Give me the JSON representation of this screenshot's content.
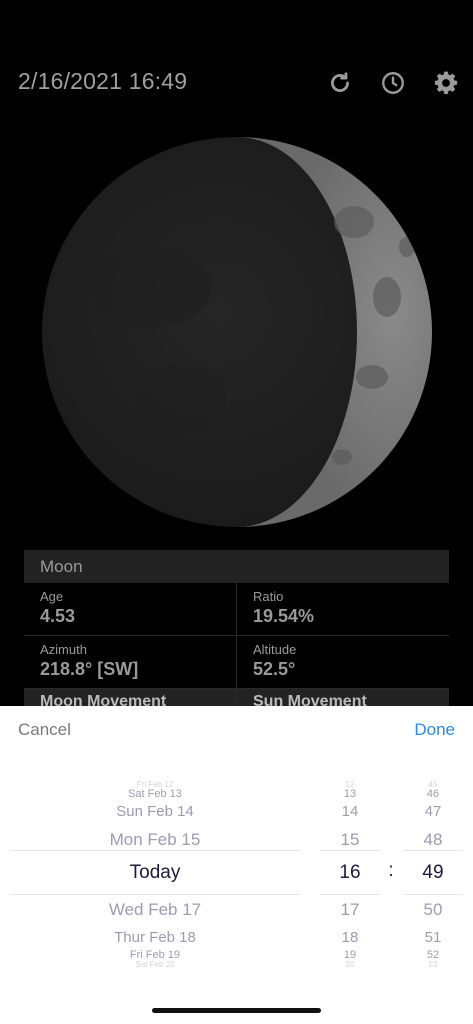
{
  "header": {
    "datetime": "2/16/2021 16:49",
    "icons": [
      "refresh-icon",
      "clock-icon",
      "gear-icon"
    ]
  },
  "moon_table": {
    "title": "Moon",
    "rows": [
      [
        {
          "label": "Age",
          "value": "4.53"
        },
        {
          "label": "Ratio",
          "value": "19.54%"
        }
      ],
      [
        {
          "label": "Azimuth",
          "value": "218.8° [SW]"
        },
        {
          "label": "Altitude",
          "value": "52.5°"
        }
      ]
    ],
    "partial_row": [
      "Moon Movement",
      "Sun Movement"
    ]
  },
  "picker": {
    "cancel_label": "Cancel",
    "done_label": "Done",
    "dates": [
      "Fri Feb 12",
      "Sat Feb 13",
      "Sun Feb 14",
      "Mon Feb 15",
      "Today",
      "Wed Feb 17",
      "Thur Feb 18",
      "Fri Feb 19",
      "Sat Feb 20"
    ],
    "hours": [
      "12",
      "13",
      "14",
      "15",
      "16",
      "17",
      "18",
      "19",
      "20"
    ],
    "minutes": [
      "45",
      "46",
      "47",
      "48",
      "49",
      "50",
      "51",
      "52",
      "53"
    ],
    "separator": ":"
  },
  "colors": {
    "background": "#000000",
    "accent": "#2b8ae2",
    "text_dim": "#9a9a9a",
    "picker_selected": "#1b1b3a"
  }
}
